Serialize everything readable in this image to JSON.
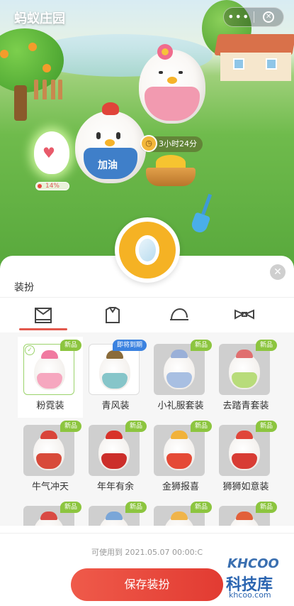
{
  "header": {
    "title": "蚂蚁庄园",
    "more_label": "•••",
    "close_label": "✕"
  },
  "scene": {
    "timer_text": "3小时24分",
    "overalls_text": "加油",
    "egg_progress_label": "14%",
    "egg_progress": 0.14
  },
  "sheet": {
    "title": "装扮",
    "close_label": "✕",
    "tabs": [
      {
        "name": "outfit",
        "icon": "outfit-icon",
        "active": true
      },
      {
        "name": "clothes",
        "icon": "shirt-icon",
        "active": false
      },
      {
        "name": "hat",
        "icon": "hat-icon",
        "active": false
      },
      {
        "name": "accessory",
        "icon": "bow-icon",
        "active": false
      }
    ],
    "items": [
      {
        "name": "粉霓装",
        "badge": "新品",
        "selected": true
      },
      {
        "name": "青风装",
        "badge": "即将到期",
        "unlocked": true
      },
      {
        "name": "小礼服套装",
        "badge": "新品"
      },
      {
        "name": "去踏青套装",
        "badge": "新品"
      },
      {
        "name": "牛气冲天",
        "badge": "新品"
      },
      {
        "name": "年年有余",
        "badge": "新品"
      },
      {
        "name": "金狮报喜",
        "badge": "新品"
      },
      {
        "name": "狮狮如意装",
        "badge": "新品"
      },
      {
        "name": "",
        "badge": "新品"
      },
      {
        "name": "",
        "badge": "新品"
      },
      {
        "name": "",
        "badge": "新品"
      },
      {
        "name": "",
        "badge": "新品"
      }
    ],
    "valid_until": "可使用到 2021.05.07 00:00:C",
    "save_label": "保存装扮"
  },
  "watermark": {
    "line1": "KHCOO",
    "line2": "科技库",
    "line3": "khcoo.com"
  },
  "colors": {
    "accent": "#e23b32",
    "badge_green": "#8cc53f",
    "badge_blue": "#3b82e0",
    "mirror": "#f5b224"
  }
}
